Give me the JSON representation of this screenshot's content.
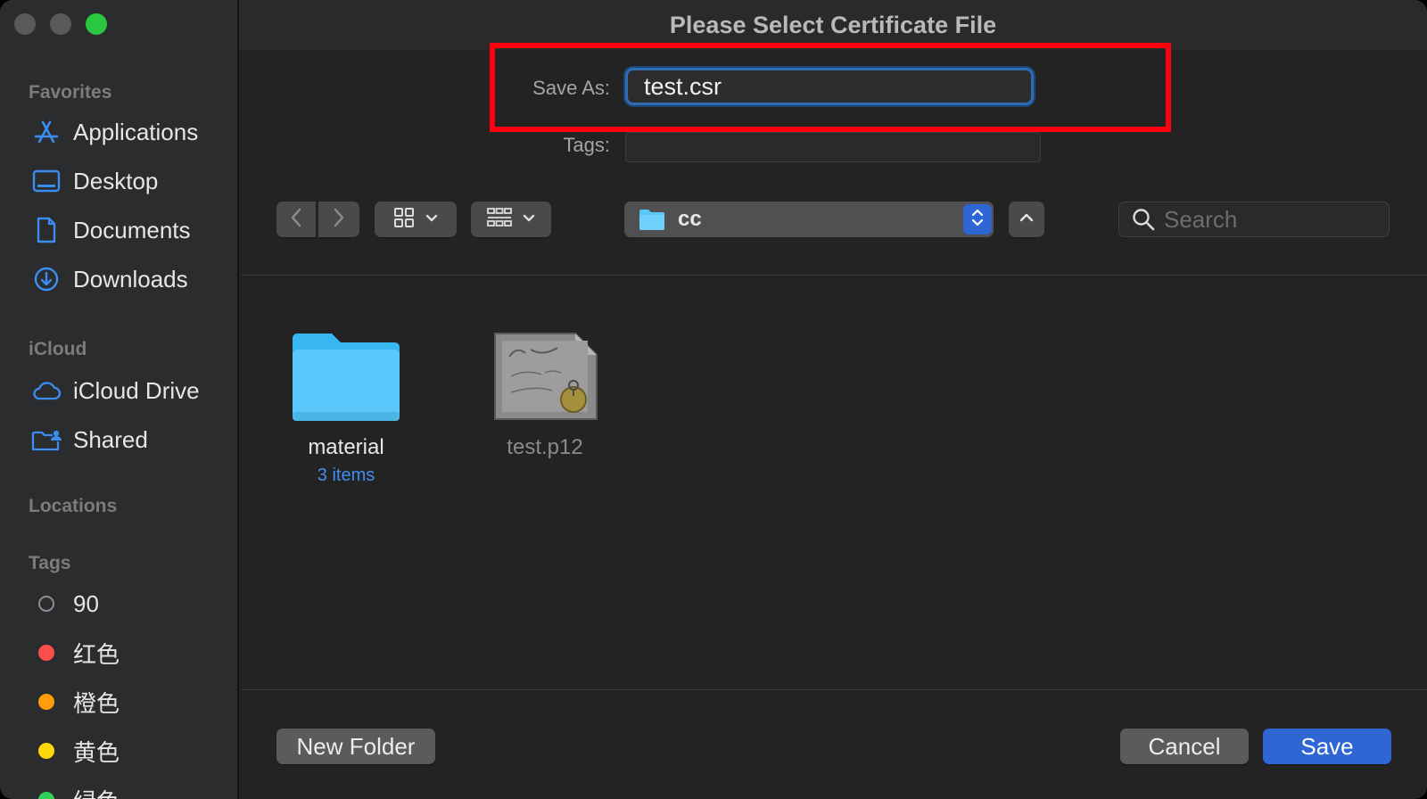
{
  "window": {
    "title": "Please Select Certificate File"
  },
  "sidebar": {
    "sections": {
      "favorites": "Favorites",
      "icloud": "iCloud",
      "locations": "Locations",
      "tags": "Tags"
    },
    "favorites": [
      {
        "label": "Applications",
        "icon": "applications-icon"
      },
      {
        "label": "Desktop",
        "icon": "desktop-icon"
      },
      {
        "label": "Documents",
        "icon": "document-icon"
      },
      {
        "label": "Downloads",
        "icon": "downloads-icon"
      }
    ],
    "icloud": [
      {
        "label": "iCloud Drive",
        "icon": "cloud-icon"
      },
      {
        "label": "Shared",
        "icon": "shared-folder-icon"
      }
    ],
    "tags": [
      {
        "label": "90",
        "color": "none"
      },
      {
        "label": "红色",
        "color": "#ff4f4c"
      },
      {
        "label": "橙色",
        "color": "#ff9d0a"
      },
      {
        "label": "黄色",
        "color": "#ffd60a"
      },
      {
        "label": "绿色",
        "color": "#30d158"
      }
    ]
  },
  "form": {
    "save_as_label": "Save As:",
    "save_as_value": "test.csr",
    "tags_label": "Tags:",
    "tags_value": ""
  },
  "toolbar": {
    "location": "cc",
    "search_placeholder": "Search"
  },
  "files": [
    {
      "name": "material",
      "subtitle": "3 items",
      "kind": "folder",
      "enabled": true
    },
    {
      "name": "test.p12",
      "subtitle": "",
      "kind": "certificate",
      "enabled": false
    }
  ],
  "buttons": {
    "new_folder": "New Folder",
    "cancel": "Cancel",
    "save": "Save"
  },
  "colors": {
    "accent": "#2e66d3",
    "highlight_box": "#ff0010",
    "folder": "#5ac8fa"
  }
}
